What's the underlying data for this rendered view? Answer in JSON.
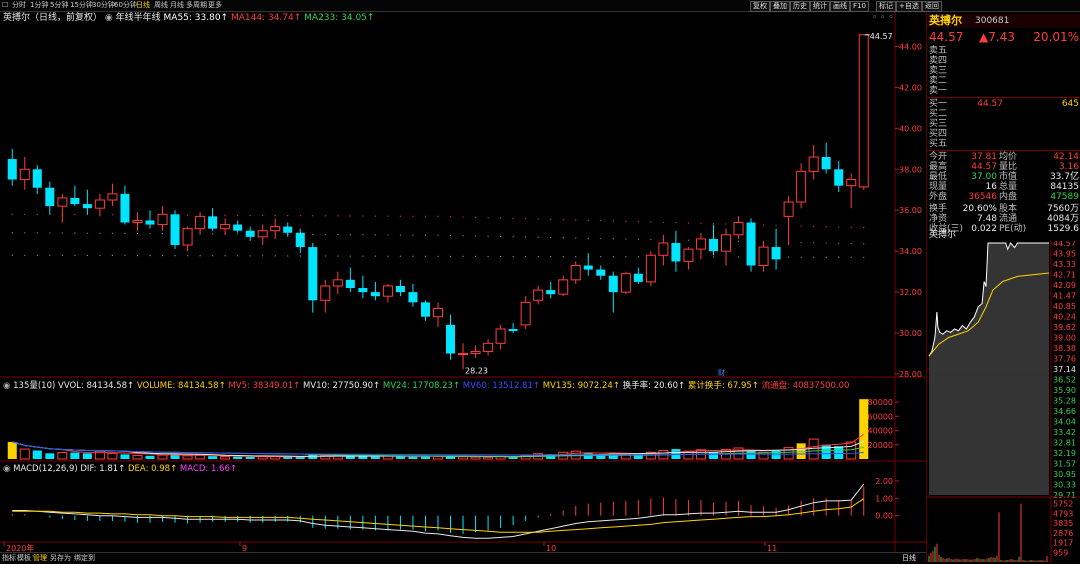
{
  "toolbar": {
    "periods": [
      "分时",
      "1分钟",
      "5分钟",
      "15分钟",
      "30分钟",
      "60分钟",
      "日线",
      "周线",
      "月线",
      "多周期",
      "更多"
    ],
    "active_period": "日线",
    "right_buttons": [
      "复权",
      "叠加",
      "历史",
      "统计",
      "画线",
      "F10",
      "标记",
      "+自选",
      "返回"
    ]
  },
  "stock": {
    "name": "英搏尔",
    "code": "300681",
    "chart_label": "英搏尔（日线，前复权）",
    "price": "44.57",
    "change": "▲7.43",
    "change_pct": "20.01%"
  },
  "price_header": {
    "ma_label": "年线半年线",
    "ma55": "MA55: 33.80↑",
    "ma144": "MA144: 34.74↑",
    "ma233": "MA233: 34.05↑"
  },
  "vol_header": {
    "name": "135量(10)",
    "vvol": "VVOL: 84134.58↑",
    "volume": "VOLUME: 84134.58↑",
    "mv5": "MV5: 38349.01↑",
    "mv10": "MV10: 27750.90↑",
    "mv24": "MV24: 17708.23↑",
    "mv60": "MV60: 13512.81↑",
    "mv135": "MV135: 9072.24↑",
    "turnover": "换手率: 20.60↑",
    "cum_turnover": "累计换手: 67.95↑",
    "float_cap": "流通盘: 40837500.00"
  },
  "macd_header": {
    "name": "MACD(12,26,9)",
    "dif": "DIF: 1.81↑",
    "dea": "DEA: 0.98↑",
    "macd": "MACD: 1.66↑"
  },
  "chart_data": {
    "type": "candlestick",
    "price_ylim": [
      28,
      45
    ],
    "price_ticks": [
      "44.00",
      "42.00",
      "40.00",
      "38.00",
      "36.00",
      "34.00",
      "32.00",
      "30.00",
      "28.00"
    ],
    "last_high_label": "44.57",
    "low_label": "28.23",
    "event_marker": "财",
    "volume_ticks": [
      "80000",
      "60000",
      "40000",
      "20000"
    ],
    "macd_ticks": [
      "2.00",
      "1.00",
      "0.00"
    ],
    "x_labels": [
      "2020年",
      "9",
      "10",
      "11"
    ],
    "candles": [
      [
        38.5,
        39.0,
        37.2,
        37.5
      ],
      [
        37.5,
        38.6,
        37.0,
        38.0
      ],
      [
        38.0,
        38.2,
        36.8,
        37.1
      ],
      [
        37.1,
        37.4,
        35.8,
        36.2
      ],
      [
        36.2,
        36.8,
        35.4,
        36.6
      ],
      [
        36.6,
        37.2,
        36.2,
        36.3
      ],
      [
        36.3,
        37.0,
        35.8,
        36.1
      ],
      [
        36.1,
        36.8,
        35.7,
        36.5
      ],
      [
        36.5,
        37.3,
        36.2,
        36.8
      ],
      [
        36.8,
        37.2,
        35.3,
        35.4
      ],
      [
        35.4,
        35.9,
        35.0,
        35.5
      ],
      [
        35.5,
        36.0,
        35.1,
        35.3
      ],
      [
        35.3,
        36.2,
        35.0,
        35.8
      ],
      [
        35.8,
        36.0,
        34.1,
        34.3
      ],
      [
        34.3,
        35.2,
        34.0,
        35.1
      ],
      [
        35.1,
        35.9,
        34.8,
        35.7
      ],
      [
        35.7,
        36.1,
        35.0,
        35.1
      ],
      [
        35.1,
        35.6,
        34.8,
        35.3
      ],
      [
        35.3,
        35.5,
        34.9,
        35.0
      ],
      [
        35.0,
        35.2,
        34.5,
        34.7
      ],
      [
        34.7,
        35.3,
        34.3,
        35.0
      ],
      [
        35.0,
        35.6,
        34.6,
        35.2
      ],
      [
        35.2,
        35.4,
        34.7,
        34.9
      ],
      [
        34.9,
        35.1,
        33.9,
        34.2
      ],
      [
        34.2,
        34.4,
        31.0,
        31.6
      ],
      [
        31.6,
        32.6,
        31.0,
        32.3
      ],
      [
        32.3,
        33.0,
        31.9,
        32.6
      ],
      [
        32.6,
        33.2,
        32.0,
        32.2
      ],
      [
        32.2,
        32.8,
        31.7,
        32.0
      ],
      [
        32.0,
        32.5,
        31.6,
        31.8
      ],
      [
        31.8,
        32.4,
        31.5,
        32.3
      ],
      [
        32.3,
        32.6,
        31.8,
        32.0
      ],
      [
        32.0,
        32.4,
        31.3,
        31.5
      ],
      [
        31.5,
        31.6,
        30.6,
        30.8
      ],
      [
        30.8,
        31.5,
        30.3,
        31.2
      ],
      [
        30.4,
        30.9,
        28.7,
        29.0
      ],
      [
        29.0,
        29.5,
        28.23,
        29.0
      ],
      [
        29.0,
        29.4,
        28.8,
        29.1
      ],
      [
        29.1,
        29.7,
        28.9,
        29.5
      ],
      [
        29.5,
        30.4,
        29.2,
        30.2
      ],
      [
        30.2,
        30.5,
        30.0,
        30.1
      ],
      [
        30.4,
        31.8,
        30.2,
        31.5
      ],
      [
        31.6,
        32.3,
        31.4,
        32.1
      ],
      [
        32.1,
        32.5,
        31.7,
        31.9
      ],
      [
        31.9,
        32.8,
        31.8,
        32.6
      ],
      [
        32.6,
        33.5,
        32.4,
        33.3
      ],
      [
        33.3,
        33.9,
        32.8,
        33.1
      ],
      [
        33.1,
        33.3,
        32.6,
        32.8
      ],
      [
        32.8,
        33.0,
        31.0,
        32.0
      ],
      [
        32.0,
        33.0,
        31.9,
        32.9
      ],
      [
        32.9,
        33.2,
        32.4,
        32.5
      ],
      [
        32.5,
        34.0,
        32.3,
        33.8
      ],
      [
        33.8,
        34.8,
        33.3,
        34.4
      ],
      [
        34.4,
        35.0,
        33.0,
        33.5
      ],
      [
        33.5,
        34.2,
        33.1,
        34.1
      ],
      [
        34.1,
        34.9,
        33.6,
        34.6
      ],
      [
        34.6,
        35.3,
        33.8,
        34.0
      ],
      [
        34.0,
        35.1,
        33.3,
        34.8
      ],
      [
        34.8,
        35.7,
        34.6,
        35.4
      ],
      [
        35.4,
        35.6,
        33.0,
        33.3
      ],
      [
        33.3,
        34.5,
        33.0,
        34.2
      ],
      [
        34.2,
        35.1,
        33.1,
        33.6
      ],
      [
        35.7,
        36.7,
        34.3,
        36.4
      ],
      [
        36.4,
        38.3,
        36.1,
        37.9
      ],
      [
        37.9,
        39.2,
        37.5,
        38.6
      ],
      [
        38.6,
        39.3,
        37.8,
        38.0
      ],
      [
        38.0,
        38.4,
        36.9,
        37.2
      ],
      [
        37.2,
        37.8,
        36.1,
        37.5
      ],
      [
        37.14,
        44.57,
        37.0,
        44.57
      ]
    ],
    "volumes": [
      24000,
      14000,
      12000,
      8000,
      9000,
      9000,
      8000,
      11000,
      8000,
      6500,
      5000,
      4500,
      5500,
      7000,
      4500,
      5200,
      4000,
      3500,
      3200,
      3000,
      3300,
      3600,
      3000,
      2900,
      6800,
      5600,
      5200,
      3800,
      3500,
      3300,
      4200,
      3900,
      3300,
      4000,
      3700,
      5000,
      3100,
      2600,
      2400,
      3400,
      3000,
      5200,
      7500,
      6800,
      9500,
      11000,
      8500,
      6000,
      7800,
      7000,
      6000,
      9500,
      12000,
      14000,
      11000,
      13000,
      10000,
      13500,
      15500,
      12000,
      9500,
      11500,
      16000,
      22000,
      28000,
      20000,
      18000,
      24000,
      84134
    ],
    "macd_bars": [
      0.1,
      0.1,
      0.0,
      -0.1,
      -0.2,
      -0.25,
      -0.3,
      -0.3,
      -0.3,
      -0.35,
      -0.4,
      -0.4,
      -0.35,
      -0.4,
      -0.45,
      -0.4,
      -0.35,
      -0.35,
      -0.35,
      -0.4,
      -0.4,
      -0.35,
      -0.35,
      -0.4,
      -0.7,
      -0.75,
      -0.75,
      -0.8,
      -0.8,
      -0.85,
      -0.85,
      -0.8,
      -0.8,
      -0.9,
      -0.85,
      -1.0,
      -1.05,
      -0.95,
      -0.85,
      -0.7,
      -0.55,
      -0.3,
      -0.1,
      0.1,
      0.3,
      0.55,
      0.7,
      0.75,
      0.8,
      0.85,
      0.9,
      1.0,
      1.05,
      0.95,
      0.9,
      0.9,
      0.75,
      0.8,
      0.85,
      0.6,
      0.55,
      0.45,
      0.6,
      0.85,
      1.0,
      1.0,
      0.9,
      0.9,
      1.66
    ],
    "dif": [
      0.3,
      0.3,
      0.25,
      0.2,
      0.15,
      0.1,
      0.05,
      0.0,
      0.0,
      -0.05,
      -0.1,
      -0.1,
      -0.1,
      -0.15,
      -0.2,
      -0.2,
      -0.2,
      -0.2,
      -0.2,
      -0.25,
      -0.25,
      -0.25,
      -0.25,
      -0.3,
      -0.45,
      -0.55,
      -0.6,
      -0.65,
      -0.7,
      -0.75,
      -0.8,
      -0.85,
      -0.9,
      -1.0,
      -1.05,
      -1.15,
      -1.25,
      -1.3,
      -1.3,
      -1.25,
      -1.2,
      -1.05,
      -0.9,
      -0.75,
      -0.6,
      -0.45,
      -0.35,
      -0.3,
      -0.25,
      -0.2,
      -0.15,
      -0.05,
      0.05,
      0.05,
      0.1,
      0.15,
      0.15,
      0.2,
      0.25,
      0.2,
      0.2,
      0.2,
      0.35,
      0.55,
      0.75,
      0.85,
      0.85,
      0.9,
      1.81
    ],
    "dea": [
      0.25,
      0.25,
      0.25,
      0.25,
      0.2,
      0.2,
      0.15,
      0.15,
      0.1,
      0.1,
      0.05,
      0.05,
      0.0,
      0.0,
      -0.05,
      -0.05,
      -0.05,
      -0.1,
      -0.1,
      -0.1,
      -0.1,
      -0.1,
      -0.1,
      -0.15,
      -0.2,
      -0.25,
      -0.3,
      -0.35,
      -0.4,
      -0.45,
      -0.5,
      -0.55,
      -0.6,
      -0.65,
      -0.7,
      -0.75,
      -0.8,
      -0.85,
      -0.9,
      -0.95,
      -0.95,
      -0.95,
      -0.95,
      -0.9,
      -0.85,
      -0.8,
      -0.75,
      -0.7,
      -0.65,
      -0.6,
      -0.55,
      -0.5,
      -0.4,
      -0.35,
      -0.3,
      -0.25,
      -0.2,
      -0.15,
      -0.1,
      -0.05,
      -0.05,
      0.0,
      0.05,
      0.15,
      0.25,
      0.35,
      0.4,
      0.5,
      0.98
    ]
  },
  "orderbook": {
    "asks": [
      {
        "label": "卖五"
      },
      {
        "label": "卖四"
      },
      {
        "label": "卖三"
      },
      {
        "label": "卖二"
      },
      {
        "label": "卖一"
      }
    ],
    "bids": [
      {
        "label": "买一",
        "price": "44.57",
        "vol": "645"
      },
      {
        "label": "买二"
      },
      {
        "label": "买三"
      },
      {
        "label": "买四"
      },
      {
        "label": "买五"
      }
    ]
  },
  "stats": [
    {
      "l1": "今开",
      "v1": "37.81",
      "c1": "red",
      "l2": "均价",
      "v2": "42.14",
      "c2": "red"
    },
    {
      "l1": "最高",
      "v1": "44.57",
      "c1": "red",
      "l2": "量比",
      "v2": "3.16",
      "c2": "red"
    },
    {
      "l1": "最低",
      "v1": "37.00",
      "c1": "green",
      "l2": "市值",
      "v2": "33.7亿",
      "c2": "white"
    },
    {
      "l1": "现量",
      "v1": "16",
      "c1": "white",
      "l2": "总量",
      "v2": "84135",
      "c2": "white"
    },
    {
      "l1": "外盘",
      "v1": "36546",
      "c1": "red",
      "l2": "内盘",
      "v2": "47589",
      "c2": "green"
    },
    {
      "l1": "换手",
      "v1": "20.60%",
      "c1": "white",
      "l2": "股本",
      "v2": "7560万",
      "c2": "white"
    },
    {
      "l1": "净资",
      "v1": "7.48",
      "c1": "white",
      "l2": "流通",
      "v2": "4084万",
      "c2": "white"
    },
    {
      "l1": "收益(三)",
      "v1": "0.022",
      "c1": "white",
      "l2": "PE(动)",
      "v2": "1529.6",
      "c2": "white"
    }
  ],
  "mini": {
    "title": "英搏尔",
    "price_ticks": [
      "44.57",
      "43.95",
      "43.33",
      "42.71",
      "42.09",
      "41.47",
      "40.85",
      "40.24",
      "39.62",
      "39.00",
      "38.38",
      "37.76",
      "37.14",
      "36.52",
      "35.90",
      "35.28",
      "34.66",
      "34.04",
      "33.42",
      "32.81",
      "32.19",
      "31.57",
      "30.95",
      "30.33",
      "29.71"
    ],
    "vol_ticks": [
      "5752",
      "4793",
      "3835",
      "2876",
      "1917",
      "959"
    ],
    "footer": "日线"
  },
  "bottom_tabs": [
    "指标",
    "模板",
    "管理",
    "另存为",
    "绑定到"
  ],
  "bottom_active": "管理",
  "colors": {
    "up": "#ff3c3c",
    "down": "#00e5ff",
    "ma55": "#ffffff",
    "ma144": "#ff3c3c",
    "ma233": "#33d24d"
  }
}
